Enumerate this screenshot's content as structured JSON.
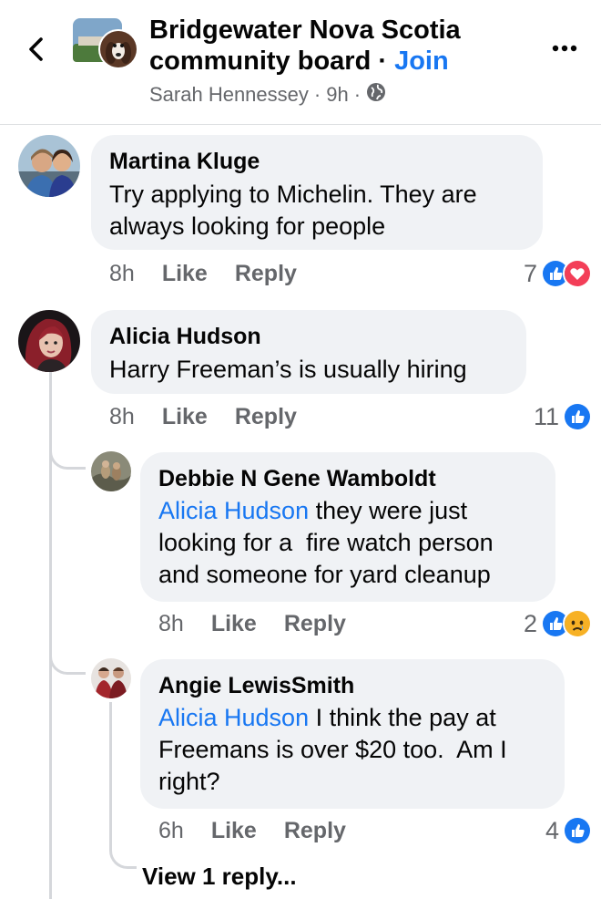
{
  "header": {
    "group_name_line1": "Bridgewater Nova Scotia",
    "group_name_line2": "community board",
    "separator": " · ",
    "join_label": "Join",
    "author": "Sarah Hennessey",
    "dot": "·",
    "time": "9h",
    "privacy_icon": "globe-icon",
    "back_icon": "chevron-left-icon",
    "more_icon": "more-dots-icon"
  },
  "comments": [
    {
      "author": "Martina Kluge",
      "text_line1": "Try applying to Michelin. They are",
      "text_line2": "always looking for people",
      "time": "8h",
      "like_label": "Like",
      "reply_label": "Reply",
      "reaction_count": "7",
      "reactions": [
        "like-icon",
        "love-icon"
      ]
    },
    {
      "author": "Alicia Hudson",
      "text_line1": "Harry Freeman’s is usually hiring",
      "time": "8h",
      "like_label": "Like",
      "reply_label": "Reply",
      "reaction_count": "11",
      "reactions": [
        "like-icon"
      ]
    }
  ],
  "replies": [
    {
      "author": "Debbie N Gene Wamboldt",
      "mention": "Alicia Hudson",
      "text_line1_rest": " they were just",
      "text_line2": "looking for a  fire watch person",
      "text_line3": "and someone for yard cleanup",
      "time": "8h",
      "like_label": "Like",
      "reply_label": "Reply",
      "reaction_count": "2",
      "reactions": [
        "like-icon",
        "sad-icon"
      ]
    },
    {
      "author": "Angie LewisSmith",
      "mention": "Alicia Hudson",
      "text_line1_rest": " I think the pay at",
      "text_line2": "Freemans is over $20 too.  Am I",
      "text_line3": "right?",
      "time": "6h",
      "like_label": "Like",
      "reply_label": "Reply",
      "reaction_count": "4",
      "reactions": [
        "like-icon"
      ]
    }
  ],
  "view_replies_label": "View 1 reply...",
  "colors": {
    "accent": "#1877f2",
    "bubble": "#f0f2f5",
    "secondary_text": "#65676b",
    "love": "#f33e58",
    "sad": "#f7b125"
  }
}
